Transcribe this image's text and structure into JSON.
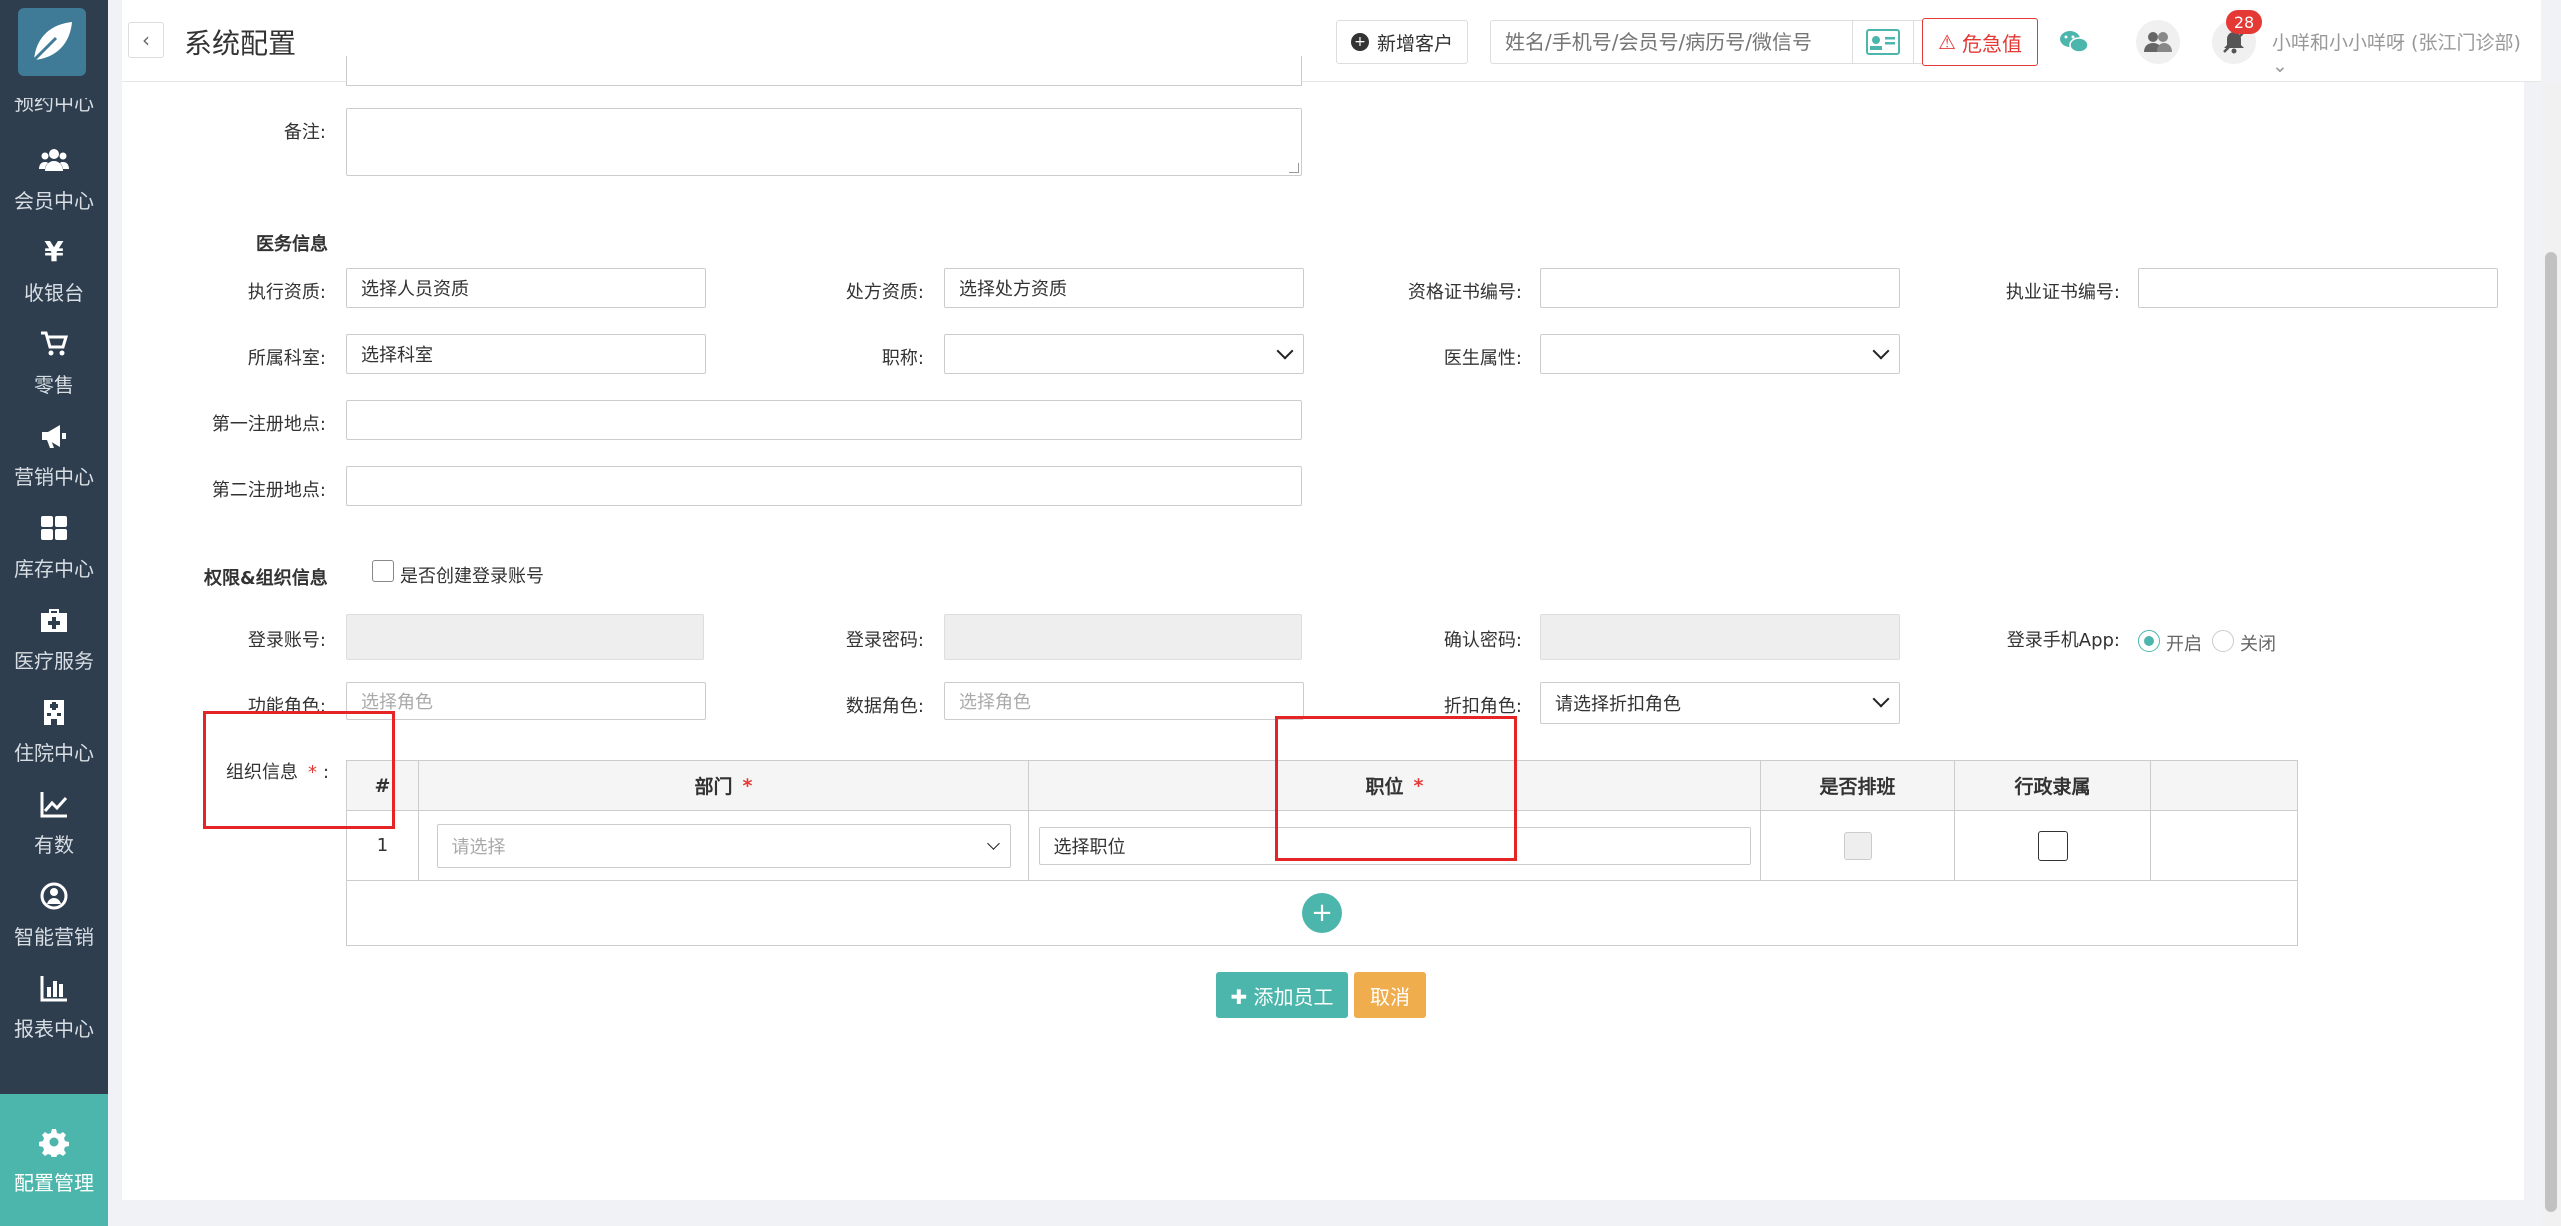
{
  "sidebar": {
    "partial_label": "预约中心",
    "items": [
      {
        "label": "会员中心",
        "icon": "users-icon"
      },
      {
        "label": "收银台",
        "icon": "yen-icon"
      },
      {
        "label": "零售",
        "icon": "cart-icon"
      },
      {
        "label": "营销中心",
        "icon": "megaphone-icon"
      },
      {
        "label": "库存中心",
        "icon": "grid-icon"
      },
      {
        "label": "医疗服务",
        "icon": "medkit-icon"
      },
      {
        "label": "住院中心",
        "icon": "hospital-icon"
      },
      {
        "label": "有数",
        "icon": "trend-icon"
      },
      {
        "label": "智能营销",
        "icon": "ai-icon"
      },
      {
        "label": "报表中心",
        "icon": "bar-chart-icon"
      },
      {
        "label": "配置管理",
        "icon": "gear-icon",
        "active": true
      }
    ]
  },
  "header": {
    "back": "‹",
    "title": "系统配置",
    "new_customer": "新增客户",
    "search_placeholder": "姓名/手机号/会员号/病历号/微信号",
    "clear": "×",
    "danger": "危急值",
    "badge": "28",
    "user": "小咩和小小咩呀 (张江门诊部) ⌄"
  },
  "form": {
    "remark_label": "备注:",
    "medical_section": "医务信息",
    "exec_label": "执行资质:",
    "exec_value": "选择人员资质",
    "rx_label": "处方资质:",
    "rx_value": "选择处方资质",
    "cert_label": "资格证书编号:",
    "license_label": "执业证书编号:",
    "dept_label": "所属科室:",
    "dept_value": "选择科室",
    "title_label": "职称:",
    "doctor_attr_label": "医生属性:",
    "reg1_label": "第一注册地点:",
    "reg2_label": "第二注册地点:",
    "perm_section": "权限&组织信息",
    "create_account": "是否创建登录账号",
    "account_label": "登录账号:",
    "password_label": "登录密码:",
    "confirm_label": "确认密码:",
    "app_label": "登录手机App:",
    "app_on": "开启",
    "app_off": "关闭",
    "func_role_label": "功能角色:",
    "func_role_ph": "选择角色",
    "data_role_label": "数据角色:",
    "data_role_ph": "选择角色",
    "discount_label": "折扣角色:",
    "discount_value": "请选择折扣角色",
    "org_label": "组织信息",
    "org_req": "*",
    "org_colon": ":"
  },
  "table": {
    "headers": {
      "index": "#",
      "dept": "部门",
      "position": "职位",
      "shift": "是否排班",
      "admin": "行政隶属"
    },
    "req": "*",
    "rows": [
      {
        "index": "1",
        "dept_ph": "请选择",
        "position": "选择职位"
      }
    ],
    "add": "+"
  },
  "actions": {
    "add_staff": "✚ 添加员工",
    "cancel": "取消"
  }
}
